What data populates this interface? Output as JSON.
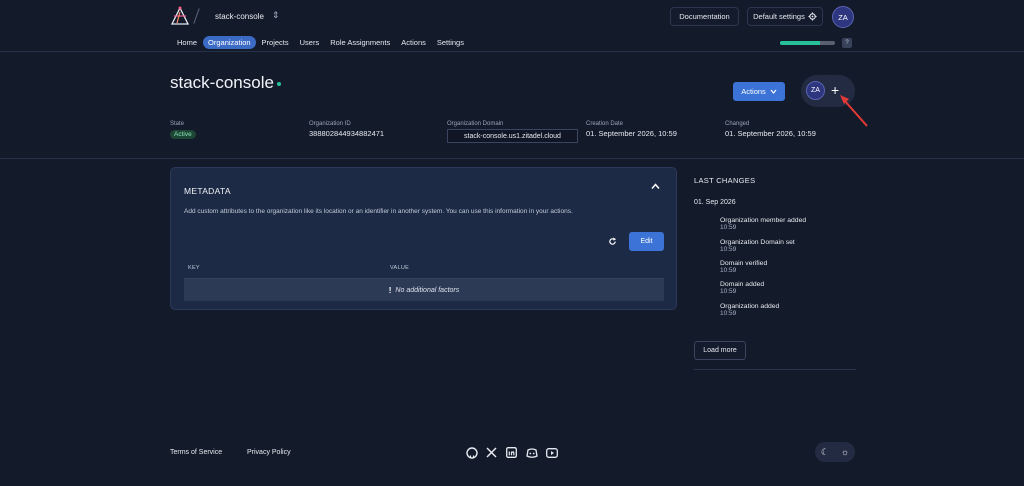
{
  "header": {
    "org_name": "stack-console",
    "documentation_label": "Documentation",
    "settings_label": "Default settings",
    "user_initials": "ZA",
    "help_label": "?",
    "progress": 0.72
  },
  "nav": {
    "items": [
      {
        "label": "Home"
      },
      {
        "label": "Organization"
      },
      {
        "label": "Projects"
      },
      {
        "label": "Users"
      },
      {
        "label": "Role Assignments"
      },
      {
        "label": "Actions"
      },
      {
        "label": "Settings"
      }
    ],
    "active_index": 1
  },
  "page": {
    "title": "stack-console",
    "actions_label": "Actions",
    "member_initials": "ZA",
    "add_member_symbol": "+"
  },
  "info": {
    "state": {
      "label": "State",
      "value": "Active"
    },
    "org_id": {
      "label": "Organization ID",
      "value": "388802844934882471"
    },
    "domain": {
      "label": "Organization Domain",
      "value": "stack-console.us1.zitadel.cloud"
    },
    "created": {
      "label": "Creation Date",
      "value": "01. September 2026, 10:59"
    },
    "changed": {
      "label": "Changed",
      "value": "01. September 2026, 10:59"
    }
  },
  "metadata": {
    "title": "METADATA",
    "description": "Add custom attributes to the organization like its location or an identifier in another system. You can use this information in your actions.",
    "edit_label": "Edit",
    "columns": [
      "KEY",
      "VALUE"
    ],
    "empty_text": "No additional factors",
    "empty_icon": "!"
  },
  "last_changes": {
    "title": "LAST CHANGES",
    "date": "01. Sep 2026",
    "items": [
      {
        "name": "Organization member added",
        "time": "10:59"
      },
      {
        "name": "Organization Domain set",
        "time": "10:59"
      },
      {
        "name": "Domain verified",
        "time": "10:59"
      },
      {
        "name": "Domain added",
        "time": "10:59"
      },
      {
        "name": "Organization added",
        "time": "10:59"
      }
    ],
    "load_more_label": "Load more"
  },
  "footer": {
    "terms_label": "Terms of Service",
    "privacy_label": "Privacy Policy",
    "socials": [
      "github-icon",
      "x-icon",
      "linkedin-icon",
      "discord-icon",
      "youtube-icon"
    ]
  },
  "colors": {
    "background": "#131a2a",
    "accent": "#3c73d6",
    "success": "#27c29a",
    "card": "#1d2a45"
  }
}
